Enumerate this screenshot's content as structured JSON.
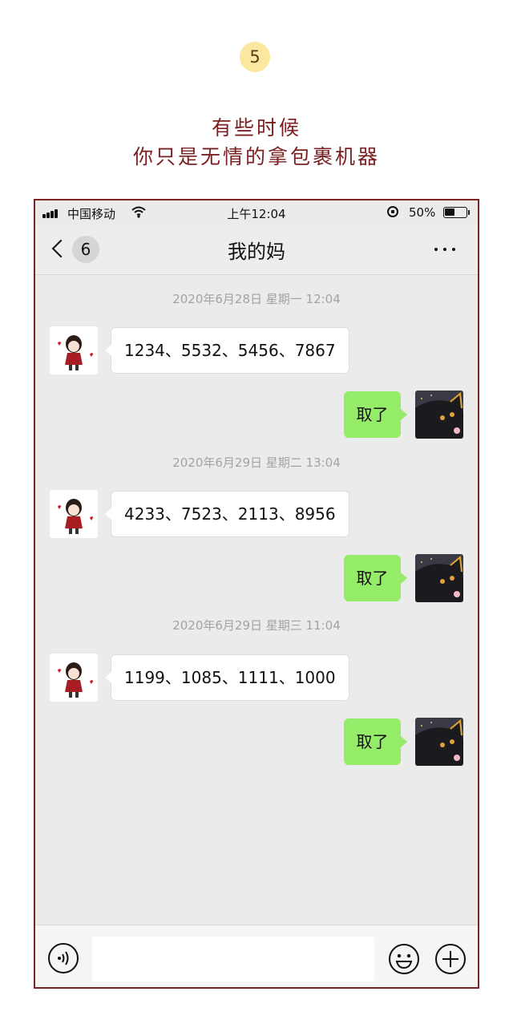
{
  "header": {
    "step_number": "5",
    "caption_line1": "有些时候",
    "caption_line2": "你只是无情的拿包裹机器"
  },
  "status_bar": {
    "carrier": "中国移动",
    "time": "上午12:04",
    "battery_percent": "50%",
    "battery_level": 0.5,
    "icons": [
      "signal-icon",
      "wifi-icon",
      "orientation-lock-icon",
      "battery-icon"
    ]
  },
  "nav": {
    "title": "我的妈",
    "unread_count": "6",
    "icons": [
      "back-icon",
      "more-icon"
    ]
  },
  "chat": {
    "timestamps": [
      "2020年6月28日 星期一 12:04",
      "2020年6月29日 星期二 13:04",
      "2020年6月29日 星期三 11:04"
    ],
    "incoming": [
      "1234、5532、5456、7867",
      "4233、7523、2113、8956",
      "1199、1085、1111、1000"
    ],
    "outgoing": [
      "取了",
      "取了",
      "取了"
    ]
  },
  "input_bar": {
    "text_value": "",
    "icons": [
      "voice-icon",
      "emoji-icon",
      "add-icon"
    ]
  },
  "colors": {
    "frame": "#7a2424",
    "caption": "#7a1f22",
    "badge_bg": "#fbe7a0",
    "chat_bg": "#ebebeb",
    "outgoing_bubble": "#95ec69",
    "incoming_bubble": "#ffffff"
  }
}
